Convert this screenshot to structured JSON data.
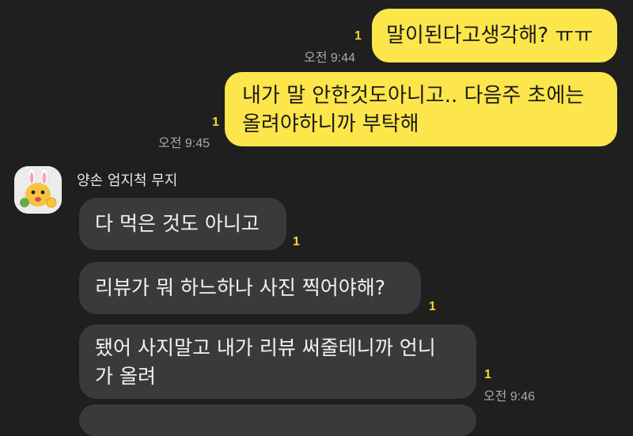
{
  "messages_out": [
    {
      "text": "말이된다고생각해? ㅠㅠ",
      "unread": "1",
      "time": "오전 9:44"
    },
    {
      "line1": "내가 말 안한것도아니고.. 다음주 초에는",
      "line2": "올려야하니까 부탁해",
      "unread": "1",
      "time": "오전 9:45"
    }
  ],
  "sender": {
    "name": "양손 엄지척 무지",
    "avatar": "muzi-avatar"
  },
  "messages_in": [
    {
      "text": "다 먹은 것도 아니고",
      "unread": "1"
    },
    {
      "text": "리뷰가 뭐 하느하나 사진 찍어야해?",
      "unread": "1"
    },
    {
      "line1": "됐어 사지말고 내가 리뷰 써줄테니까 언니",
      "line2": "가 올려",
      "unread": "1",
      "time": "오전 9:46"
    }
  ],
  "colors": {
    "background": "#1f1f1f",
    "outgoing": "#fde64b",
    "incoming": "#3a3a3a",
    "unread": "#f3d63a"
  }
}
